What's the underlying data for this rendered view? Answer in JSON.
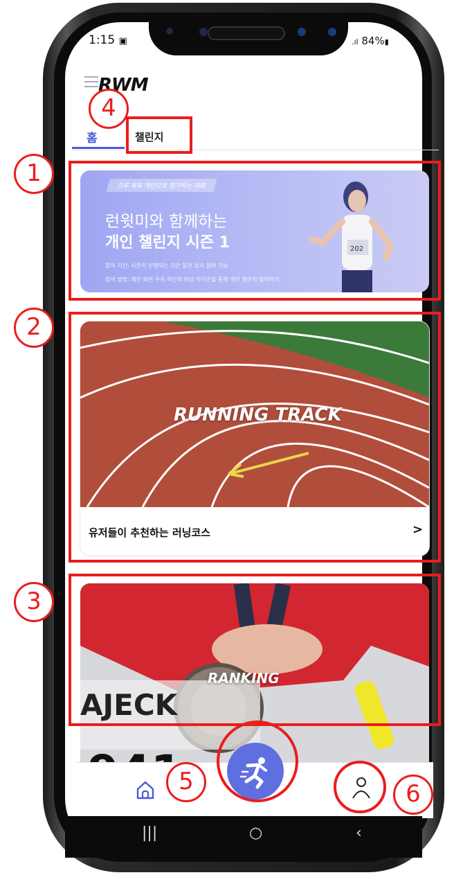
{
  "status_bar": {
    "time": "1:15",
    "right": "84%"
  },
  "app": {
    "logo": "RWM"
  },
  "tabs": [
    {
      "label": "홈",
      "active": true
    },
    {
      "label": "챌린지",
      "active": false
    }
  ],
  "banner": {
    "pill": "크루 체육 개인으로 참가하는 대회",
    "line1": "런윗미와 함께하는",
    "line2": "개인 챌린지 시즌 1",
    "detail1": "참여 기간: 시즌이 진행되는 기간 동안 상시 참여 가능",
    "detail2": "참여 방법: 메인 화면 우측 하단의 러닝 아이콘을 통해 개인 챌린지 참여하기"
  },
  "running_track_card": {
    "image_title": "RUNNING TRACK",
    "caption": "유저들이 추천하는 러닝코스",
    "chevron": ">"
  },
  "ranking_card": {
    "image_title": "RANKING"
  },
  "annotations": [
    "1",
    "2",
    "3",
    "4",
    "5",
    "6"
  ],
  "colors": {
    "accent": "#5f6fe0",
    "tab_active": "#4a5bd8",
    "highlight": "#ea1d1d"
  },
  "icons": {
    "home": "home-icon",
    "profile": "profile-icon",
    "run": "running-person-icon"
  }
}
